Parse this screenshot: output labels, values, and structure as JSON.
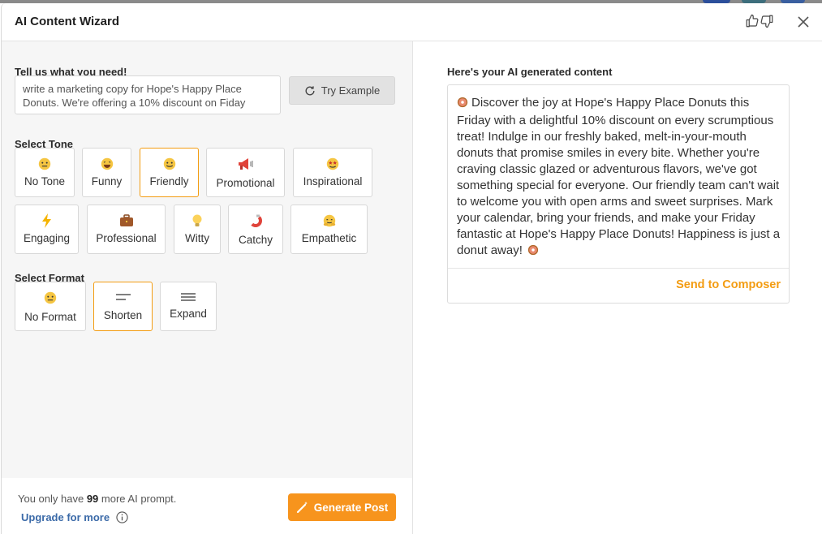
{
  "window": {
    "title": "AI Content Wizard"
  },
  "header": {
    "like_icon": "thumbs-up-icon",
    "dislike_icon": "thumbs-down-icon",
    "close_icon": "close-icon"
  },
  "input": {
    "label": "Tell us what you need!",
    "value": "write a marketing copy for Hope's Happy Place Donuts. We're offering a 10% discount on Fiday",
    "try_example_label": "Try Example"
  },
  "tone": {
    "label": "Select Tone",
    "options": [
      {
        "label": "No Tone",
        "icon": "neutral-face-icon",
        "selected": false
      },
      {
        "label": "Funny",
        "icon": "laughing-face-icon",
        "selected": false
      },
      {
        "label": "Friendly",
        "icon": "smiling-face-icon",
        "selected": true
      },
      {
        "label": "Promotional",
        "icon": "megaphone-icon",
        "selected": false
      },
      {
        "label": "Inspirational",
        "icon": "star-struck-face-icon",
        "selected": false
      },
      {
        "label": "Engaging",
        "icon": "lightning-icon",
        "selected": false
      },
      {
        "label": "Professional",
        "icon": "briefcase-icon",
        "selected": false
      },
      {
        "label": "Witty",
        "icon": "lightbulb-icon",
        "selected": false
      },
      {
        "label": "Catchy",
        "icon": "magnet-icon",
        "selected": false
      },
      {
        "label": "Empathetic",
        "icon": "hugging-face-icon",
        "selected": false
      }
    ]
  },
  "format": {
    "label": "Select Format",
    "options": [
      {
        "label": "No Format",
        "icon": "neutral-face-icon",
        "selected": false
      },
      {
        "label": "Shorten",
        "icon": "short-lines-icon",
        "selected": true
      },
      {
        "label": "Expand",
        "icon": "long-lines-icon",
        "selected": false
      }
    ]
  },
  "footer": {
    "remaining_prefix": "You only have",
    "remaining_count": "99",
    "remaining_suffix": "more AI prompt.",
    "upgrade_label": "Upgrade for more",
    "generate_label": "Generate Post"
  },
  "result": {
    "label": "Here's your AI generated content",
    "text": "Discover the joy at Hope's Happy Place Donuts this Friday with a delightful 10% discount on every scrumptious treat! Indulge in our freshly baked, melt-in-your-mouth donuts that promise smiles in every bite. Whether you're craving classic glazed or adventurous flavors, we've got something special for everyone. Our friendly team can't wait to welcome you with open arms and sweet surprises. Mark your calendar, bring your friends, and make your Friday fantastic at Hope's Happy Place Donuts! Happiness is just a donut away!",
    "send_label": "Send to Composer"
  },
  "colors": {
    "accent": "#f39c12",
    "link": "#3b6aa8",
    "generate_button": "#f7941d"
  }
}
